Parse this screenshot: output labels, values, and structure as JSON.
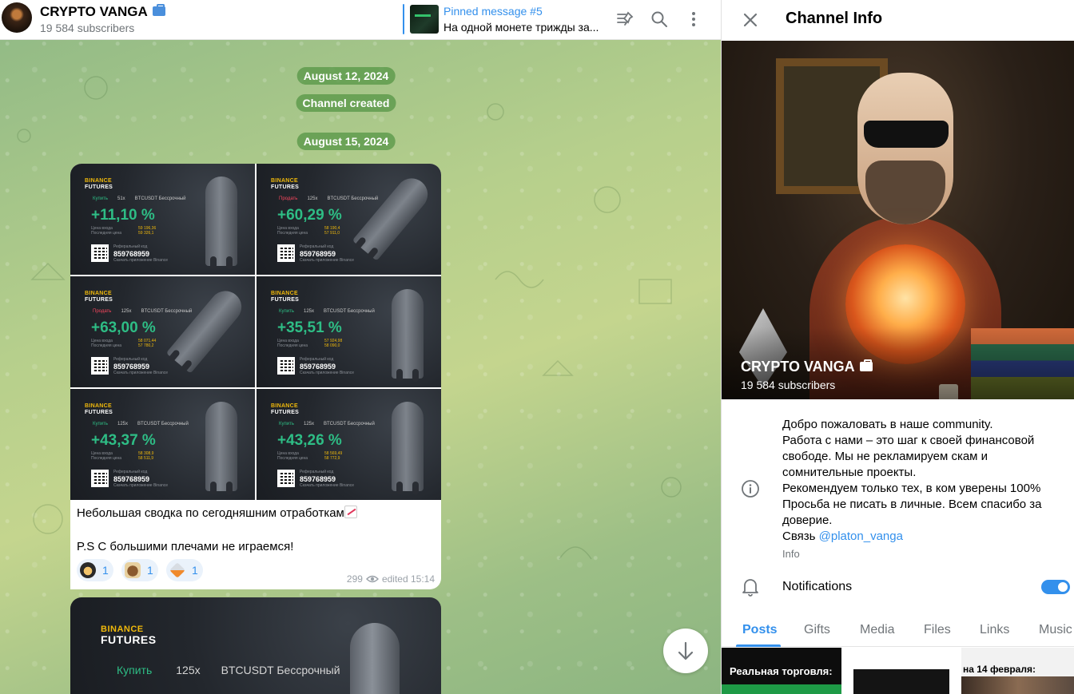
{
  "header": {
    "channel_name": "CRYPTO VANGA",
    "subscribers": "19 584 subscribers",
    "pinned": {
      "title": "Pinned message #5",
      "text": "На одной монете трижды за..."
    },
    "icons": [
      "unpin-icon",
      "search-icon",
      "more-icon"
    ]
  },
  "chat": {
    "date_1": "August 12, 2024",
    "service_1": "Channel created",
    "date_2": "August 15, 2024",
    "message": {
      "cards": [
        {
          "brand": "BINANCE",
          "product": "FUTURES",
          "side": "Купить",
          "side_type": "buy",
          "leverage": "51x",
          "pair": "BTCUSDT Бессрочный",
          "pct": "+11,10 %",
          "entry_label": "Цена входа",
          "last_label": "Последняя цена",
          "entry": "59 196,36",
          "last": "59 326,1",
          "ref_label": "Реферальный код",
          "ref_code": "859768959",
          "app_label": "Скачать приложение Binance"
        },
        {
          "brand": "BINANCE",
          "product": "FUTURES",
          "side": "Продать",
          "side_type": "sell",
          "leverage": "125x",
          "pair": "BTCUSDT Бессрочный",
          "pct": "+60,29 %",
          "entry_label": "Цена входа",
          "last_label": "Последняя цена",
          "entry": "58 190,4",
          "last": "57 911,0",
          "ref_label": "Реферальный код",
          "ref_code": "859768959",
          "app_label": "Скачать приложение Binance"
        },
        {
          "brand": "BINANCE",
          "product": "FUTURES",
          "side": "Продать",
          "side_type": "sell",
          "leverage": "125x",
          "pair": "BTCUSDT Бессрочный",
          "pct": "+63,00 %",
          "entry_label": "Цена входа",
          "last_label": "Последняя цена",
          "entry": "58 071,44",
          "last": "57 780,2",
          "ref_label": "Реферальный код",
          "ref_code": "859768959",
          "app_label": "Скачать приложение Binance"
        },
        {
          "brand": "BINANCE",
          "product": "FUTURES",
          "side": "Купить",
          "side_type": "buy",
          "leverage": "125x",
          "pair": "BTCUSDT Бессрочный",
          "pct": "+35,51 %",
          "entry_label": "Цена входа",
          "last_label": "Последняя цена",
          "entry": "57 924,98",
          "last": "58 090,0",
          "ref_label": "Реферальный код",
          "ref_code": "859768959",
          "app_label": "Скачать приложение Binance"
        },
        {
          "brand": "BINANCE",
          "product": "FUTURES",
          "side": "Купить",
          "side_type": "buy",
          "leverage": "125x",
          "pair": "BTCUSDT Бессрочный",
          "pct": "+43,37 %",
          "entry_label": "Цена входа",
          "last_label": "Последняя цена",
          "entry": "58 308,9",
          "last": "58 511,9",
          "ref_label": "Реферальный код",
          "ref_code": "859768959",
          "app_label": "Скачать приложение Binance"
        },
        {
          "brand": "BINANCE",
          "product": "FUTURES",
          "side": "Купить",
          "side_type": "buy",
          "leverage": "125x",
          "pair": "BTCUSDT Бессрочный",
          "pct": "+43,26 %",
          "entry_label": "Цена входа",
          "last_label": "Последняя цена",
          "entry": "58 569,49",
          "last": "58 772,9",
          "ref_label": "Реферальный код",
          "ref_code": "859768959",
          "app_label": "Скачать приложение Binance"
        }
      ],
      "text_line_1": "Небольшая сводка по сегодняшним отработкам",
      "text_line_2": "P.S С большими плечами не играемся!",
      "reactions": [
        {
          "emoji": "ninja-emoji",
          "count": "1"
        },
        {
          "emoji": "bear-emoji",
          "count": "1"
        },
        {
          "emoji": "rocket-emoji",
          "count": "1"
        }
      ],
      "views": "299",
      "edited": "edited 15:14"
    },
    "next_message": {
      "brand": "BINANCE",
      "product": "FUTURES",
      "side": "Купить",
      "leverage": "125x",
      "pair": "BTCUSDT Бессрочный"
    }
  },
  "panel": {
    "title": "Channel Info",
    "cover_name": "CRYPTO VANGA",
    "cover_subscribers": "19 584 subscribers",
    "info_lines": [
      "Добро пожаловать в наше community.",
      "Работа с нами – это шаг к своей финансовой",
      "свободе. Мы не рекламируем скам и",
      "сомнительные проекты.",
      "Рекомендуем только тех, в ком уверены 100%",
      "Просьба не писать в личные. Всем спасибо за",
      "доверие."
    ],
    "contact_prefix": "Связь ",
    "contact_link": "@platon_vanga",
    "info_label": "Info",
    "notifications_label": "Notifications",
    "notifications_on": true,
    "tabs": [
      "Posts",
      "Gifts",
      "Media",
      "Files",
      "Links",
      "Music"
    ],
    "active_tab": "Posts",
    "thumb_1_caption": "Реальная торговля:",
    "thumb_3_caption": "на 14 февраля:"
  },
  "colors": {
    "accent": "#3390ec",
    "profit_green": "#2ebd85",
    "sell_red": "#f6465d",
    "binance_yellow": "#f0b90b"
  }
}
